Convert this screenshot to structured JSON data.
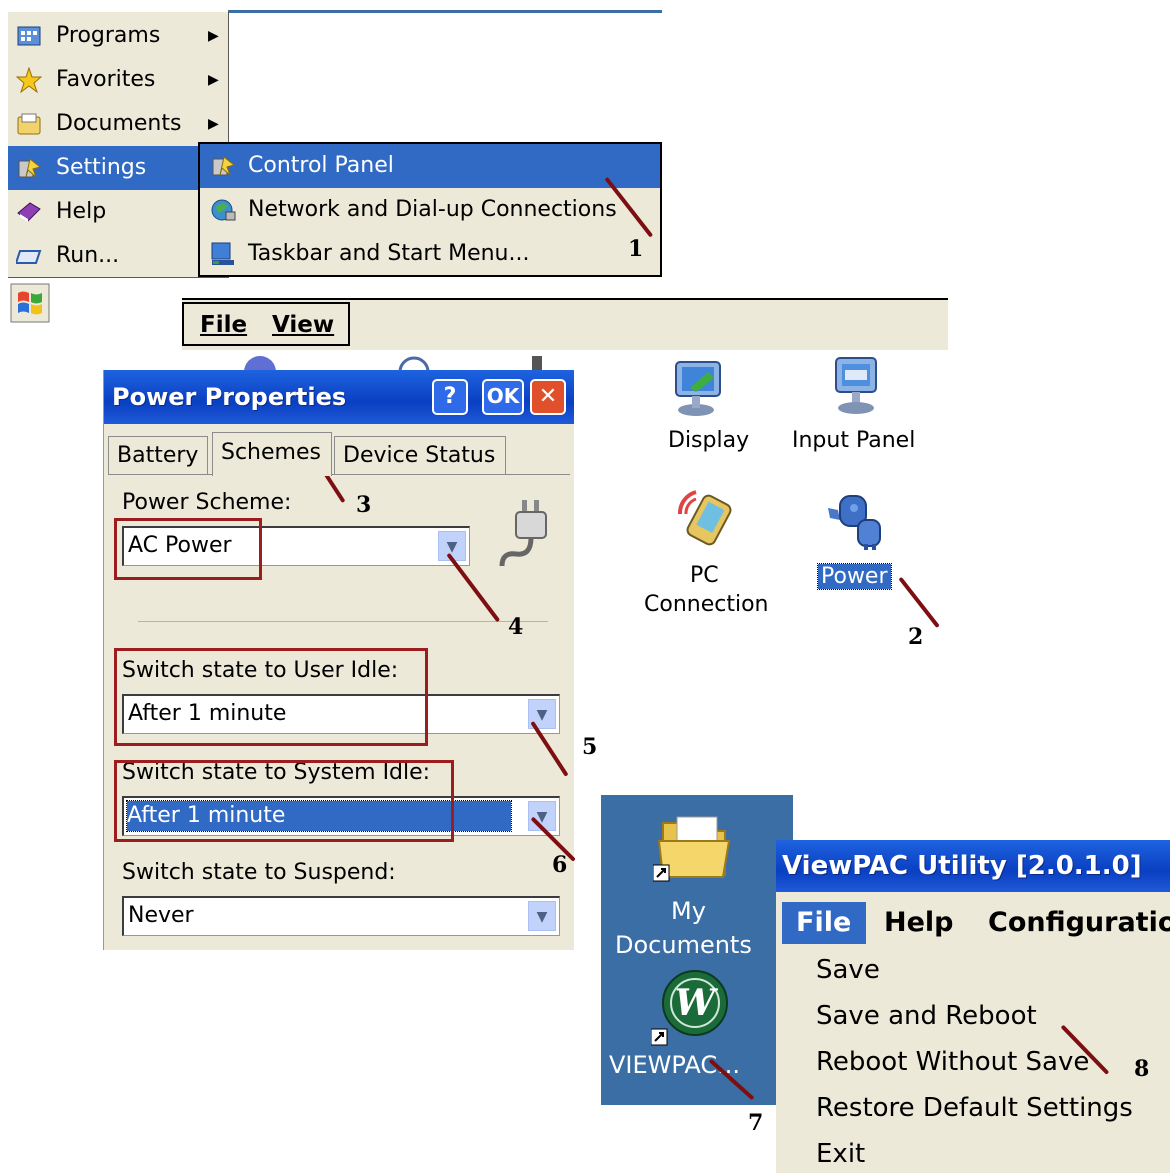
{
  "start_menu": {
    "items": [
      {
        "label": "Programs",
        "icon": "programs-icon",
        "has_submenu": true
      },
      {
        "label": "Favorites",
        "icon": "favorites-star-icon",
        "has_submenu": true
      },
      {
        "label": "Documents",
        "icon": "documents-icon",
        "has_submenu": true
      },
      {
        "label": "Settings",
        "icon": "settings-icon",
        "has_submenu": false,
        "selected": true
      },
      {
        "label": "Help",
        "icon": "help-book-icon",
        "has_submenu": false
      },
      {
        "label": "Run...",
        "icon": "run-icon",
        "has_submenu": false
      }
    ],
    "settings_submenu": [
      {
        "label": "Control Panel",
        "icon": "control-panel-icon",
        "selected": true
      },
      {
        "label": "Network and Dial-up Connections",
        "icon": "network-icon"
      },
      {
        "label": "Taskbar and Start Menu...",
        "icon": "taskbar-icon"
      }
    ]
  },
  "control_panel": {
    "menu": [
      "File",
      "View"
    ],
    "icons": [
      {
        "label": "Display",
        "icon": "display-icon"
      },
      {
        "label": "Input Panel",
        "icon": "input-panel-icon"
      },
      {
        "label": "PC\nConnection",
        "label_line1": "PC",
        "label_line2": "Connection",
        "icon": "pc-connection-icon"
      },
      {
        "label": "Power",
        "icon": "power-icon",
        "selected": true
      }
    ]
  },
  "power_dialog": {
    "title": "Power Properties",
    "buttons": {
      "help": "?",
      "ok": "OK",
      "close": "✕"
    },
    "tabs": [
      "Battery",
      "Schemes",
      "Device Status"
    ],
    "active_tab": "Schemes",
    "power_scheme_label": "Power Scheme:",
    "power_scheme_value": "AC Power",
    "user_idle_label": "Switch state to User Idle:",
    "user_idle_value": "After 1 minute",
    "system_idle_label": "Switch state to System Idle:",
    "system_idle_value": "After 1 minute",
    "suspend_label": "Switch state to Suspend:",
    "suspend_value": "Never"
  },
  "desktop": {
    "icons": [
      {
        "label_line1": "My",
        "label_line2": "Documents",
        "icon": "folder-icon"
      },
      {
        "label": "VIEWPAC...",
        "icon": "viewpac-w-icon"
      }
    ]
  },
  "viewpac_utility": {
    "title": "ViewPAC Utility [2.0.1.0]",
    "menu": [
      "File",
      "Help",
      "Configuratio"
    ],
    "file_items": [
      "Save",
      "Save and Reboot",
      "Reboot Without Save",
      "Restore Default Settings",
      "Exit"
    ]
  },
  "step_numbers": [
    "1",
    "2",
    "3",
    "4",
    "5",
    "6",
    "7",
    "8"
  ],
  "colors": {
    "selection_blue": "#316ac5",
    "desktop_blue": "#3a6ea5",
    "dialog_bg": "#ece9d8",
    "annotation_red": "#9b1d1d"
  }
}
